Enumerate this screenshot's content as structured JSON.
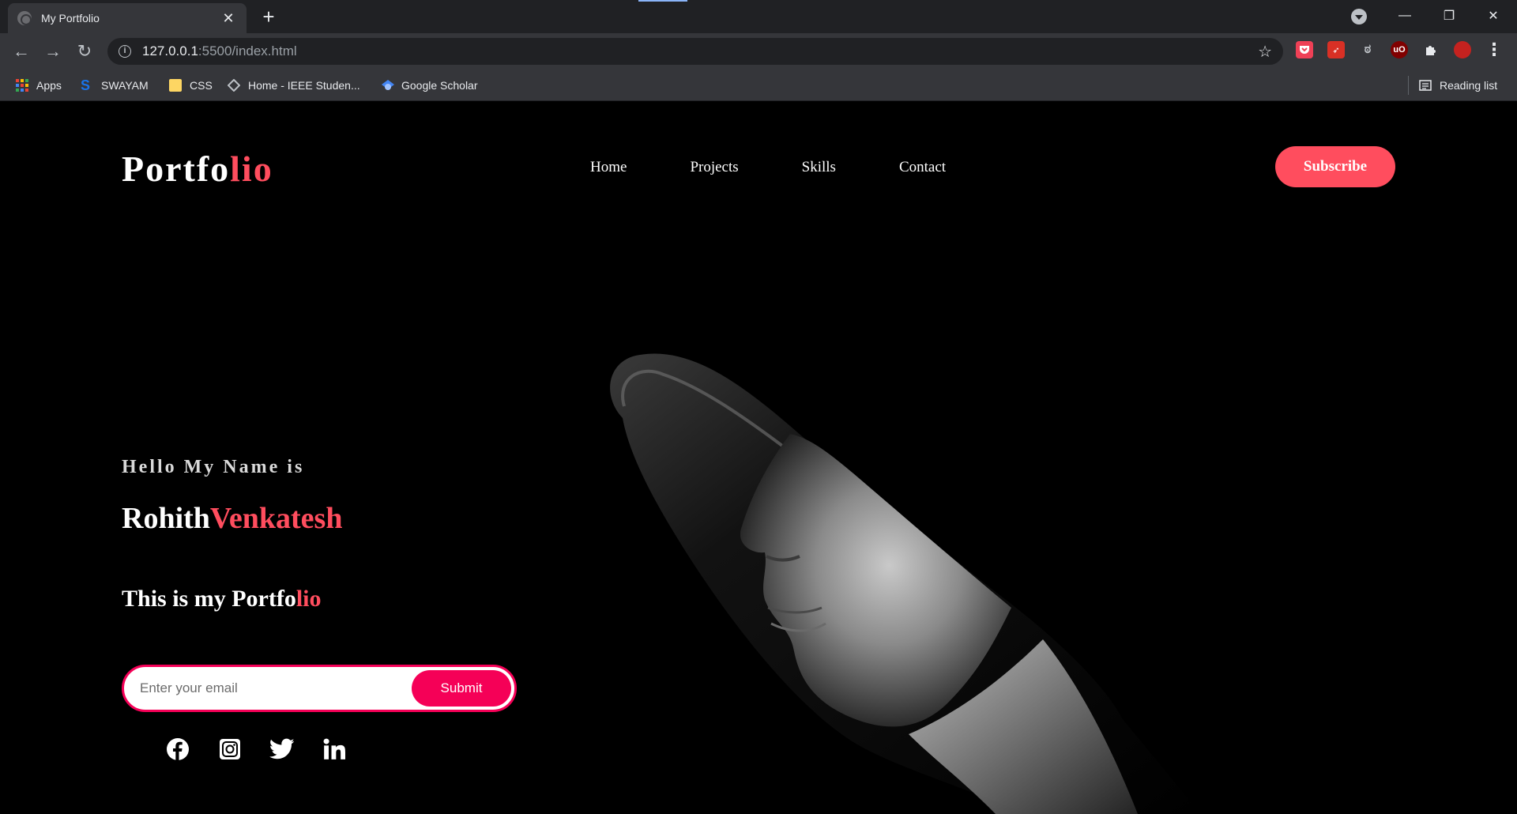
{
  "browser": {
    "tab_title": "My Portfolio",
    "tab_close": "✕",
    "new_tab": "+",
    "url_host": "127.0.0.1",
    "url_path": ":5500/index.html",
    "window_controls": {
      "minimize": "—",
      "restore": "❐",
      "close": "✕"
    }
  },
  "extensions": [
    {
      "name": "pocket",
      "color": "#ef4056"
    },
    {
      "name": "arrow-extension",
      "color": "#d93025"
    },
    {
      "name": "script-extension",
      "color": "#5f6368"
    },
    {
      "name": "ublock-origin",
      "color": "#800000"
    },
    {
      "name": "extensions-puzzle",
      "color": "#e8eaed"
    },
    {
      "name": "profile-avatar",
      "color": "#c5221f"
    }
  ],
  "bookmarks": {
    "items": [
      {
        "label": "Apps",
        "icon": "apps-grid-icon"
      },
      {
        "label": "SWAYAM",
        "icon": "swayam-icon"
      },
      {
        "label": "CSS",
        "icon": "folder-icon"
      },
      {
        "label": "Home - IEEE Studen...",
        "icon": "ieee-diamond-icon"
      },
      {
        "label": "Google Scholar",
        "icon": "scholar-icon"
      }
    ],
    "reading_list": "Reading list"
  },
  "page": {
    "logo": {
      "main": "Portfo",
      "accent": "lio"
    },
    "nav": [
      "Home",
      "Projects",
      "Skills",
      "Contact"
    ],
    "subscribe_label": "Subscribe",
    "hero": {
      "greeting": "Hello My Name is",
      "first_name": "Rohith",
      "last_name": "Venkatesh",
      "tagline_main": "This is my Portfo",
      "tagline_accent": "lio"
    },
    "form": {
      "email_placeholder": "Enter your email",
      "submit_label": "Submit"
    },
    "socials": [
      "facebook-icon",
      "instagram-icon",
      "twitter-icon",
      "linkedin-icon"
    ]
  },
  "colors": {
    "accent": "#ff4d5e",
    "form_accent": "#f50057",
    "background": "#000000"
  }
}
